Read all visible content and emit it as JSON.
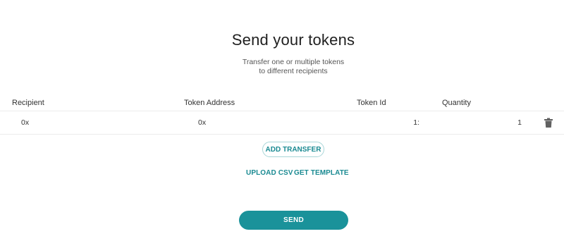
{
  "header": {
    "title": "Send your tokens",
    "subtitle_line1": "Transfer one or multiple tokens",
    "subtitle_line2": "to different recipients"
  },
  "table": {
    "columns": [
      "Recipient",
      "Token Address",
      "Token Id",
      "Quantity"
    ],
    "rows": [
      {
        "recipient": "0x",
        "token_address": "0x",
        "token_id": "1:",
        "quantity": "1",
        "delete_icon": "trash-icon"
      }
    ]
  },
  "actions": {
    "add_transfer": "ADD TRANSFER",
    "upload_csv": "UPLOAD CSV",
    "get_template": "GET TEMPLATE",
    "send": "SEND"
  },
  "colors": {
    "accent": "#1a929a",
    "accent_text": "#1a8a92",
    "border": "#a9d6d8"
  }
}
